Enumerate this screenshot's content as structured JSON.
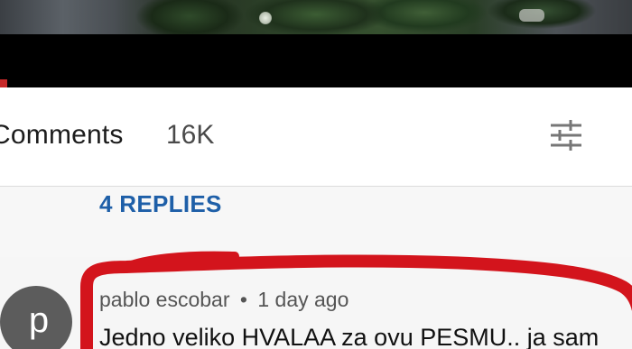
{
  "comments": {
    "title": "Comments",
    "count": "16K"
  },
  "thread": {
    "replies_label": "4 REPLIES"
  },
  "comment": {
    "avatar_letter": "p",
    "author": "pablo escobar",
    "separator": "•",
    "time": "1 day ago",
    "text": "Jedno veliko HVALAA za ovu PESMU.. ja sam"
  },
  "colors": {
    "link": "#1e5fa8",
    "highlight": "#d3141c",
    "avatar": "#5c5c5c"
  }
}
